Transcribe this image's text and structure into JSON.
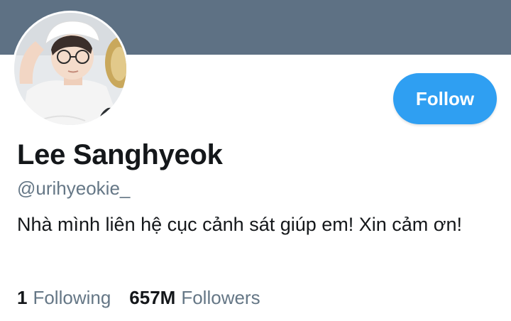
{
  "profile": {
    "name": "Lee Sanghyeok",
    "handle": "@urihyeokie_",
    "bio": "Nhà mình liên hệ cục cảnh sát giúp em! Xin cảm ơn!",
    "follow_label": "Follow",
    "following_count": "1",
    "following_label": "Following",
    "followers_count": "657M",
    "followers_label": "Followers"
  },
  "colors": {
    "banner": "#5e7184",
    "accent": "#2f9ff2",
    "text_primary": "#14171a",
    "text_secondary": "#657786"
  }
}
